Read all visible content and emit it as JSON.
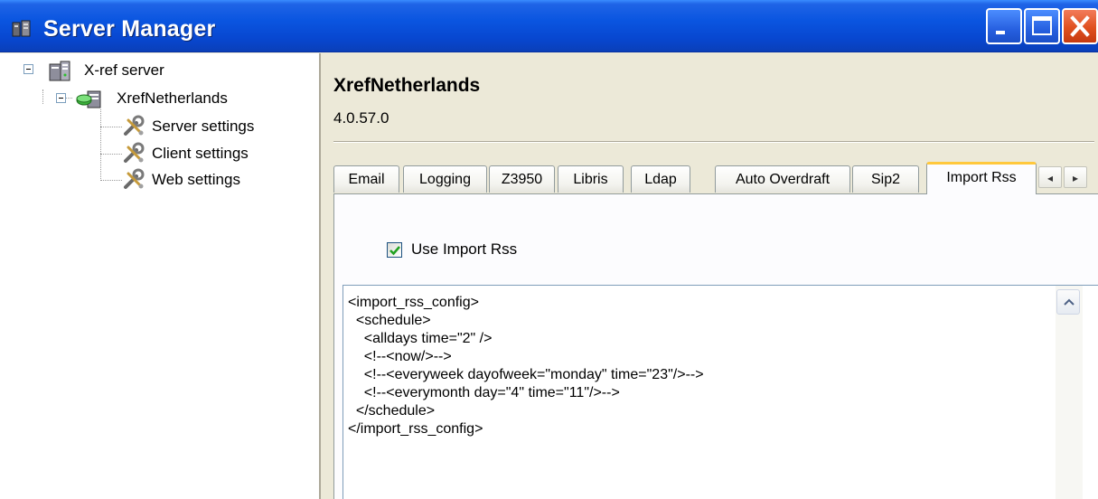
{
  "window": {
    "title": "Server Manager",
    "minimize_icon": "minimize-icon",
    "maximize_icon": "maximize-icon",
    "close_icon": "close-icon"
  },
  "tree": {
    "root": {
      "label": "X-ref server",
      "icon": "server-icon",
      "expanded": true
    },
    "server": {
      "label": "XrefNetherlands",
      "icon": "database-icon",
      "expanded": true
    },
    "items": [
      {
        "label": "Server settings",
        "icon": "settings-tools-icon"
      },
      {
        "label": "Client settings",
        "icon": "settings-tools-icon"
      },
      {
        "label": "Web settings",
        "icon": "settings-tools-icon"
      }
    ]
  },
  "header": {
    "server_name": "XrefNetherlands",
    "version": "4.0.57.0"
  },
  "tabs": [
    {
      "label": "Email",
      "active": false
    },
    {
      "label": "Logging",
      "active": false
    },
    {
      "label": "Z3950",
      "active": false
    },
    {
      "label": "Libris",
      "active": false
    },
    {
      "label": "Ldap",
      "active": false
    },
    {
      "label": "Auto Overdraft",
      "active": false
    },
    {
      "label": "Sip2",
      "active": false
    },
    {
      "label": "Import Rss",
      "active": true
    }
  ],
  "tab_scroll": {
    "left": "◂",
    "right": "▸"
  },
  "import_rss": {
    "use_checkbox_label": "Use Import Rss",
    "use_checked": true,
    "config_lines": [
      "<import_rss_config>",
      "  <schedule>",
      "    <alldays time=\"2\" />",
      "    <!--<now/>-->",
      "    <!--<everyweek dayofweek=\"monday\" time=\"23\"/>-->",
      "    <!--<everymonth day=\"4\" time=\"11\"/>-->",
      "  </schedule>",
      "</import_rss_config>"
    ]
  },
  "colors": {
    "titlebar": "#0A55E0",
    "active_tab_accent": "#FFC83C",
    "checkmark": "#21A121",
    "close_button": "#E0501F"
  }
}
